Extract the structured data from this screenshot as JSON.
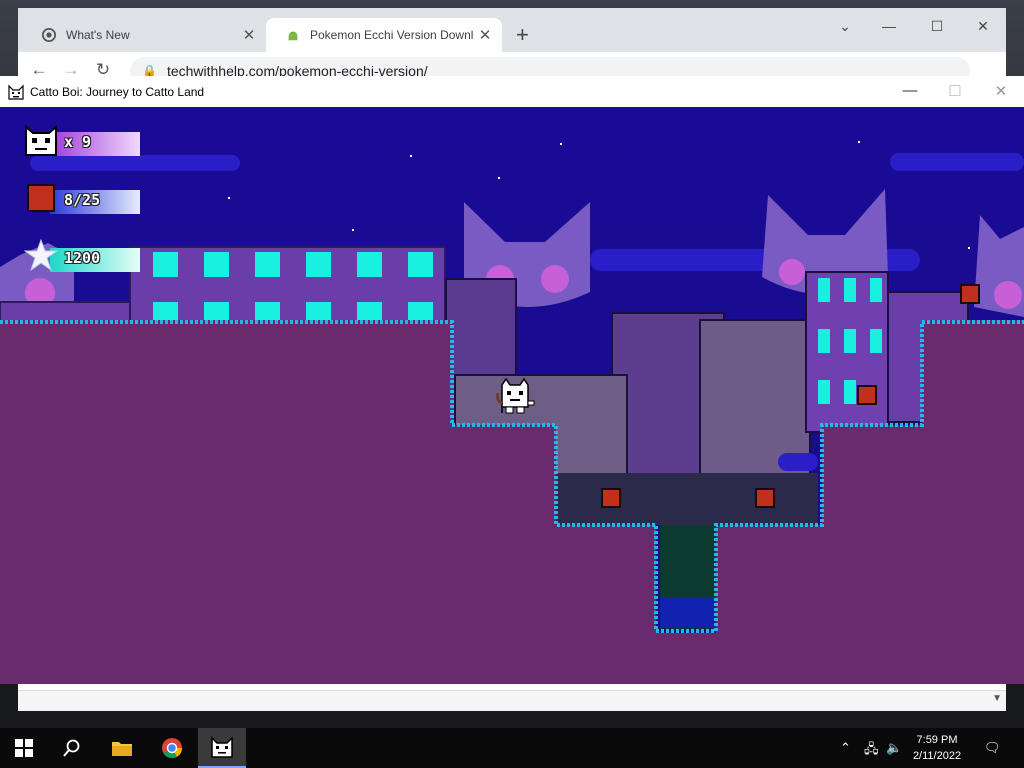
{
  "browser": {
    "tabs": [
      {
        "title": "What's New",
        "active": false
      },
      {
        "title": "Pokemon Ecchi Version Downloa",
        "active": true
      }
    ],
    "url": "techwithhelp.com/pokemon-ecchi-version/",
    "new_tab_symbol": "+",
    "icons": [
      "chrome-icon",
      "android-icon",
      "back-icon",
      "forward-icon",
      "reload-icon",
      "lock-icon",
      "share-icon",
      "star-icon",
      "profile-icon",
      "menu-icon"
    ]
  },
  "game_window": {
    "title": "Catto Boi: Journey to Catto Land",
    "hud": {
      "lives": "x 9",
      "crates": "8/25",
      "score": "1200"
    }
  },
  "taskbar": {
    "time": "7:59 PM",
    "date": "2/11/2022"
  },
  "colors": {
    "sky": "#1e0d8f",
    "ground": "#6a2a6e",
    "ground_edge": "#22b8e8",
    "building": "#5c3a90",
    "window": "#19f0e0",
    "crate": "#c0301c"
  }
}
